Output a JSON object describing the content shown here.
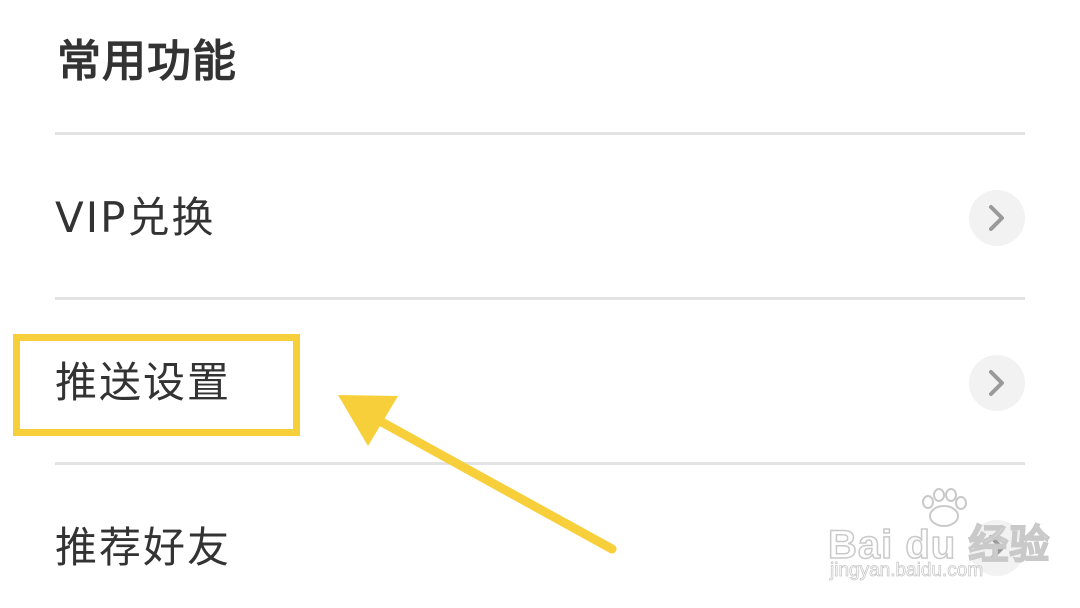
{
  "section": {
    "title": "常用功能"
  },
  "menu": {
    "items": [
      {
        "label": "VIP兑换",
        "icon": "chevron-right-icon"
      },
      {
        "label": "推送设置",
        "icon": "chevron-right-icon"
      },
      {
        "label": "推荐好友",
        "icon": "chevron-right-icon"
      }
    ]
  },
  "annotation": {
    "highlight_color": "#f7cf3a",
    "arrow_color": "#f7cf3a",
    "highlighted_item": "推送设置"
  },
  "watermark": {
    "text": "Bai du 经验",
    "url": "jingyan.baidu.com"
  }
}
